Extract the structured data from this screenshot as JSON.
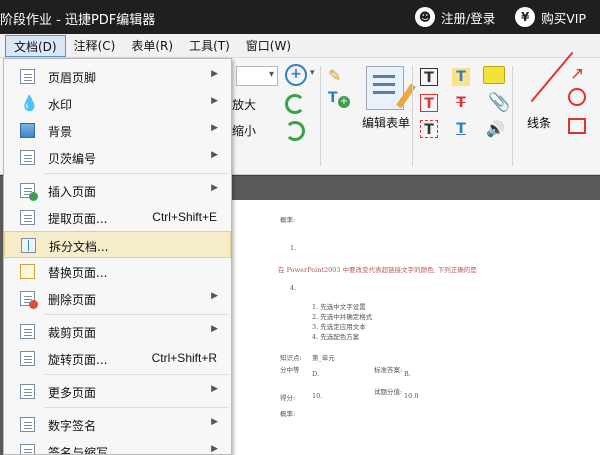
{
  "titlebar": {
    "title": "阶段作业 - 迅捷PDF编辑器",
    "login_icon": "user-icon",
    "login": "注册/登录",
    "vip_icon": "yen-icon",
    "vip": "购买VIP"
  },
  "menubar": {
    "items": [
      "文档(D)",
      "注释(C)",
      "表单(R)",
      "工具(T)",
      "窗口(W)"
    ]
  },
  "ribbon": {
    "zoom_in": "放大",
    "zoom_out": "缩小",
    "edit_form": "编辑表单",
    "lines": "线条"
  },
  "doc_menu": {
    "items": [
      {
        "label": "页眉页脚",
        "icon": "header-footer-icon",
        "shortcut": "",
        "arrow": true
      },
      {
        "label": "水印",
        "icon": "watermark-icon",
        "shortcut": "",
        "arrow": true
      },
      {
        "label": "背景",
        "icon": "background-icon",
        "shortcut": "",
        "arrow": true
      },
      {
        "label": "贝茨编号",
        "icon": "bates-number-icon",
        "shortcut": "",
        "arrow": true
      },
      {
        "label": "插入页面",
        "icon": "insert-page-icon",
        "shortcut": "",
        "arrow": true
      },
      {
        "label": "提取页面...",
        "icon": "extract-page-icon",
        "shortcut": "Ctrl+Shift+E",
        "arrow": false
      },
      {
        "label": "拆分文档...",
        "icon": "split-document-icon",
        "shortcut": "",
        "arrow": false
      },
      {
        "label": "替换页面...",
        "icon": "replace-page-icon",
        "shortcut": "",
        "arrow": false
      },
      {
        "label": "删除页面",
        "icon": "delete-page-icon",
        "shortcut": "",
        "arrow": true
      },
      {
        "label": "裁剪页面",
        "icon": "crop-page-icon",
        "shortcut": "",
        "arrow": true
      },
      {
        "label": "旋转页面...",
        "icon": "rotate-page-icon",
        "shortcut": "Ctrl+Shift+R",
        "arrow": false
      },
      {
        "label": "更多页面",
        "icon": "more-pages-icon",
        "shortcut": "",
        "arrow": true
      },
      {
        "label": "数字签名",
        "icon": "digital-signature-icon",
        "shortcut": "",
        "arrow": true
      },
      {
        "label": "签名与缩写",
        "icon": "signature-initials-icon",
        "shortcut": "",
        "arrow": true
      }
    ]
  },
  "document": {
    "lines": [
      "概率:",
      "1.",
      "在 PowerPoint2003 中要改变代表超链接文字的颜色, 下列正确的是",
      "4.",
      "1. 先选中文字设置",
      "2. 先选中并确定格式",
      "3. 先选定应用文本",
      "4. 先选配色方案",
      "知识点:",
      "第_单元",
      "分中等",
      "D.",
      "标准答案:",
      "B.",
      "得分:",
      "10.",
      "试题分值:",
      "10.0",
      "概率:"
    ]
  }
}
